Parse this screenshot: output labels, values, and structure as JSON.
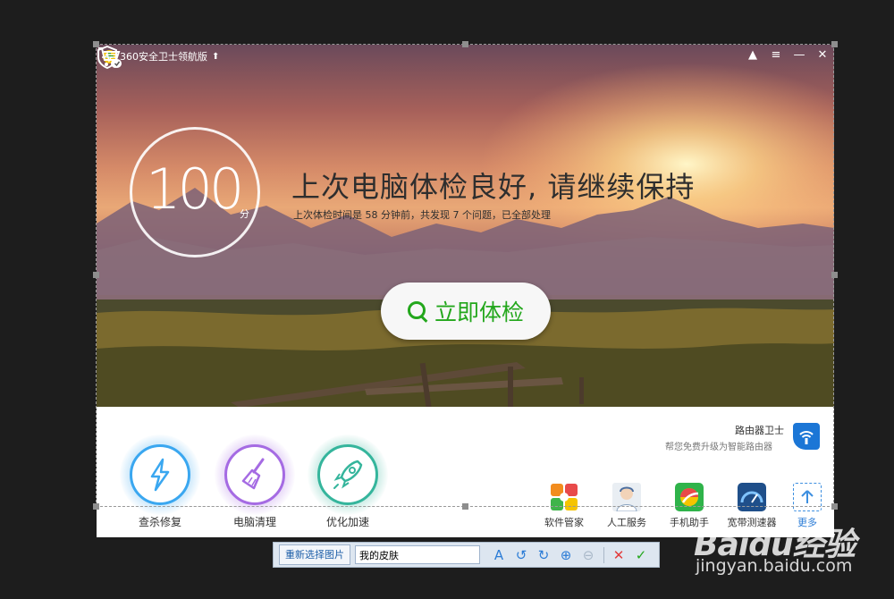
{
  "window": {
    "title": "360安全卫士领航版",
    "controls": [
      "▲",
      "≡",
      "—",
      "✕"
    ]
  },
  "score": {
    "value": "100",
    "unit": "分"
  },
  "status": {
    "headline": "上次电脑体检良好, 请继续保持",
    "detail": "上次体检时间是 58 分钟前，共发现 7 个问题，已全部处理"
  },
  "check_button": {
    "label": "立即体检"
  },
  "router": {
    "title": "路由器卫士",
    "subtitle": "帮您免费升级为智能路由器"
  },
  "features": [
    {
      "label": "查杀修复",
      "color": "#3aa7f0",
      "icon": "lightning-icon"
    },
    {
      "label": "电脑清理",
      "color": "#a56be3",
      "icon": "broom-icon"
    },
    {
      "label": "优化加速",
      "color": "#35b59c",
      "icon": "rocket-icon"
    }
  ],
  "tools": [
    {
      "label": "软件管家",
      "icon": "software-manager-icon"
    },
    {
      "label": "人工服务",
      "icon": "customer-service-icon"
    },
    {
      "label": "手机助手",
      "icon": "phone-assistant-icon"
    },
    {
      "label": "宽带测速器",
      "icon": "speed-test-icon"
    },
    {
      "label": "更多",
      "icon": "more-icon"
    }
  ],
  "toolbar": {
    "reselect_label": "重新选择图片",
    "skin_name": "我的皮肤",
    "buttons": [
      "A",
      "↺",
      "↻",
      "⊕",
      "⊖",
      "✕",
      "✓"
    ]
  },
  "watermark": {
    "brand": "Baidu经验",
    "url": "jingyan.baidu.com"
  },
  "colors": {
    "accent_green": "#23a71c",
    "router_blue": "#1b76d6",
    "more_blue": "#2b7cd6"
  }
}
